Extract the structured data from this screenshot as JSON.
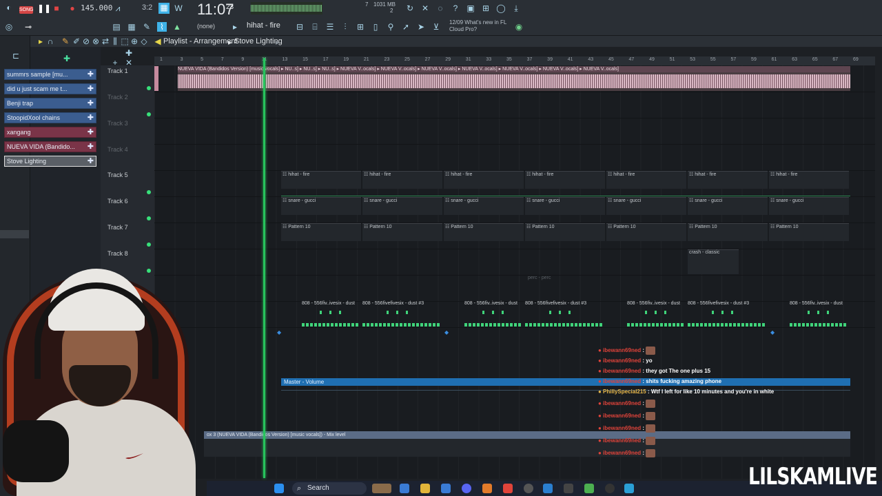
{
  "toolbar": {
    "song_mode": "SONG",
    "tempo": "145.000",
    "time_sig": "3:2",
    "clock": "11:07",
    "clock_sub": "23",
    "cpu_text": "1031 MB",
    "cpu_count": "2",
    "voices": "7",
    "pattern_select": "(none)",
    "channel_select": "hihat - fire",
    "news_date": "12/09",
    "news_text": "What's new in FL Cloud Pro?"
  },
  "playlist": {
    "title": "Playlist - Arrangement",
    "arrangement": "Stove Lighting",
    "ruler": [
      "1",
      "3",
      "5",
      "7",
      "9",
      "11",
      "13",
      "15",
      "17",
      "19",
      "21",
      "23",
      "25",
      "27",
      "29",
      "31",
      "33",
      "35",
      "37",
      "39",
      "41",
      "43",
      "45",
      "47",
      "49",
      "51",
      "53",
      "55",
      "57",
      "59",
      "61",
      "63",
      "65",
      "67",
      "69"
    ]
  },
  "picker": [
    {
      "label": "summrs sample [mu...",
      "kind": "audio"
    },
    {
      "label": "did u just scam me t...",
      "kind": "audio"
    },
    {
      "label": "Benji trap",
      "kind": "pattern"
    },
    {
      "label": "StoopidXool chains",
      "kind": "pattern"
    },
    {
      "label": "xangang",
      "kind": "audio2"
    },
    {
      "label": "NUEVA VIDA (Bandido...",
      "kind": "audio"
    },
    {
      "label": "Stove Lighting",
      "kind": "selected"
    }
  ],
  "tracks": [
    "Track 1",
    "Track 2",
    "Track 3",
    "Track 4",
    "Track 5",
    "Track 6",
    "Track 7",
    "Track 8"
  ],
  "clips": {
    "audio_header": "NUEVA VIDA (Bandidos Version) [music vocals] ▸ NU..s] ▸ NU..s] ▸ NU..s] ▸ NUEVA V..ocals] ▸ NUEVA V..ocals] ▸ NUEVA V..ocals] ▸ NUEVA V..ocals] ▸ NUEVA V..ocals] ▸ NUEVA V..ocals] ▸ NUEVA V..ocals]",
    "hihat": "hihat - fire",
    "snare": "snare - gucci",
    "pattern": "Pattern 10",
    "crash": "crash - classic",
    "perc": "perc - perc",
    "bass_a": "808 - 556fiv..ivesix - dust",
    "bass_b": "808 - 556fivefivesix - dust #3",
    "master": "Master - Volume",
    "mix": "ox 3 (NUEVA VIDA (Bandidos Version) [music vocals]) - Mix level"
  },
  "chat": [
    {
      "user": "ibewann69ned",
      "msg": ""
    },
    {
      "user": "ibewann69ned",
      "msg": "yo"
    },
    {
      "user": "ibewann69ned",
      "msg": "they got The one plus 15"
    },
    {
      "user": "ibewann69ned",
      "msg": "shits fucking amazing phone"
    },
    {
      "user": "PhillySpecial215",
      "msg": "Wtf I left for like 10 minutes and you're in white"
    },
    {
      "user": "ibewann69ned",
      "msg": ""
    },
    {
      "user": "ibewann69ned",
      "msg": ""
    },
    {
      "user": "ibewann69ned",
      "msg": ""
    },
    {
      "user": "ibewann69ned",
      "msg": ""
    },
    {
      "user": "ibewann69ned",
      "msg": ""
    }
  ],
  "taskbar": {
    "search": "Search"
  },
  "brand": "LILSKAMLIVE",
  "colors": {
    "accent": "#27c35c",
    "audio_clip": "#e8c9d4",
    "master_bar": "#1f6fb2",
    "chat_user": "#e0433a"
  }
}
